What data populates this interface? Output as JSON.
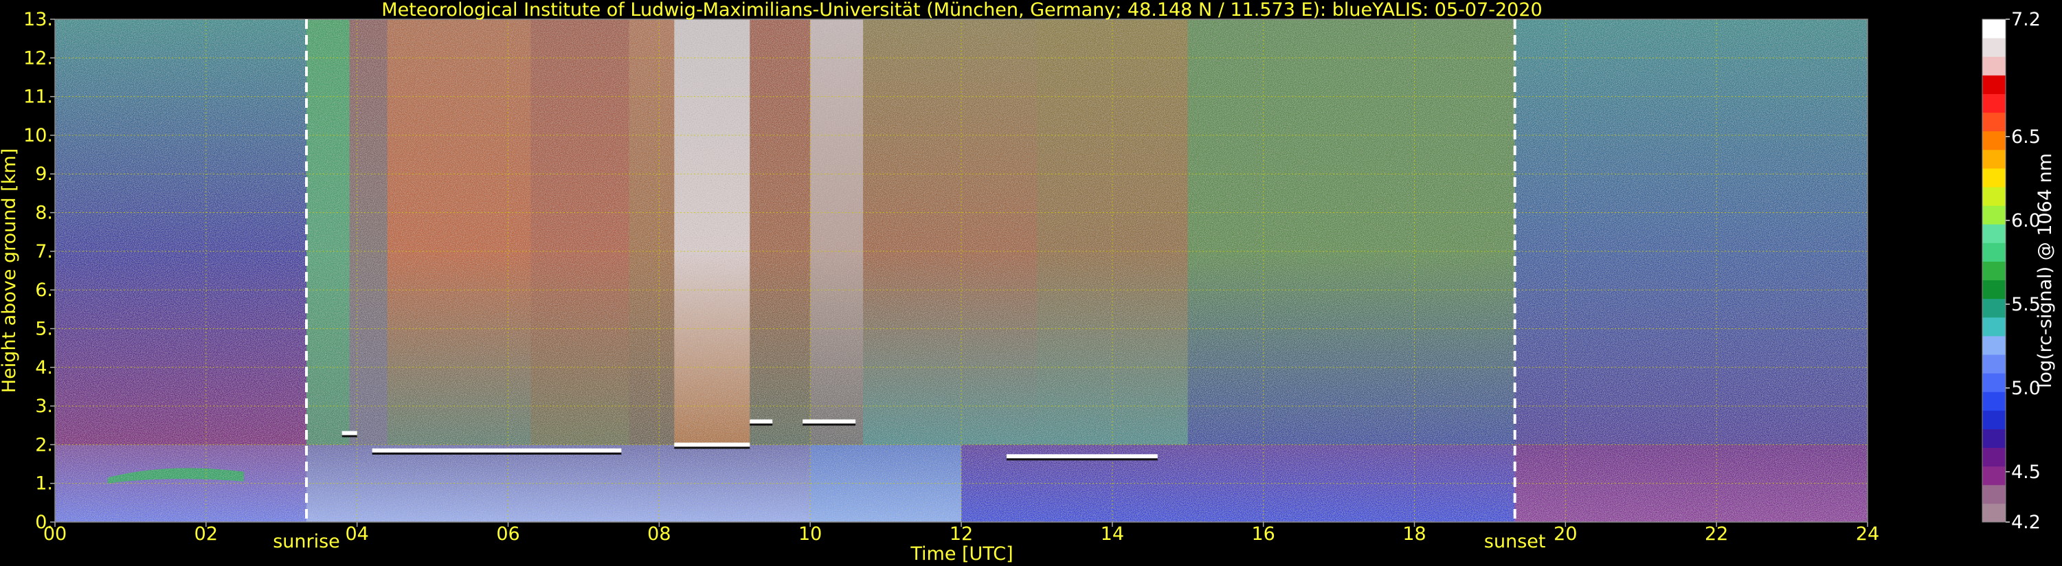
{
  "chart_data": {
    "type": "heatmap",
    "title": "Meteorological Institute of Ludwig-Maximilians-Universität (München, Germany; 48.148 N / 11.573 E):     blueYALIS: 05-07-2020",
    "xlabel": "Time [UTC]",
    "ylabel": "Height above ground [km]",
    "colorbar_label": "log(rc-signal) @ 1064 nm",
    "xlim": [
      0,
      24
    ],
    "ylim": [
      0,
      13
    ],
    "clim": [
      4.2,
      7.2
    ],
    "x_ticks": [
      0,
      2,
      4,
      6,
      8,
      10,
      12,
      14,
      16,
      18,
      20,
      22,
      24
    ],
    "x_tick_labels": [
      "00",
      "02",
      "04",
      "06",
      "08",
      "10",
      "12",
      "14",
      "16",
      "18",
      "20",
      "22",
      "24"
    ],
    "y_ticks": [
      0,
      1,
      2,
      3,
      4,
      5,
      6,
      7,
      8,
      9,
      10,
      11,
      12,
      13
    ],
    "y_tick_labels": [
      "0.",
      "1.",
      "2.",
      "3.",
      "4.",
      "5.",
      "6.",
      "7.",
      "8.",
      "9.",
      "10.",
      "11.",
      "12.",
      "13."
    ],
    "colorbar_ticks": [
      4.2,
      4.5,
      5.0,
      5.5,
      6.0,
      6.5,
      7.2
    ],
    "colorbar_tick_labels": [
      "4.2",
      "4.5",
      "5.0",
      "5.5",
      "6.0",
      "6.5",
      "7.2"
    ],
    "grid": true,
    "vlines": [
      {
        "label": "sunrise",
        "x": 3.33
      },
      {
        "label": "sunset",
        "x": 19.33
      }
    ],
    "cloud_layers": [
      {
        "x0": 3.8,
        "x1": 4.0,
        "height": 2.3
      },
      {
        "x0": 4.2,
        "x1": 7.5,
        "height": 1.85
      },
      {
        "x0": 8.2,
        "x1": 9.2,
        "height": 2.0
      },
      {
        "x0": 9.2,
        "x1": 9.5,
        "height": 2.6
      },
      {
        "x0": 9.9,
        "x1": 10.6,
        "height": 2.6
      },
      {
        "x0": 12.6,
        "x1": 14.6,
        "height": 1.7
      }
    ],
    "colormap": [
      "#a88898",
      "#9a6a8e",
      "#8a2a8a",
      "#6a1a8a",
      "#3a1aa0",
      "#2030d0",
      "#2a4af0",
      "#4a6af8",
      "#6a8af8",
      "#8ab0f8",
      "#40c0c0",
      "#20a080",
      "#109030",
      "#30b040",
      "#40d080",
      "#60e0a0",
      "#a0f040",
      "#d0f020",
      "#ffe000",
      "#ffb000",
      "#ff8000",
      "#ff5020",
      "#ff2020",
      "#e00000",
      "#f0c0c0",
      "#e8e0e0",
      "#ffffff"
    ],
    "colors": {
      "text": "#ffff33",
      "grid": "#cccc00",
      "markers": "#ffffff"
    }
  }
}
